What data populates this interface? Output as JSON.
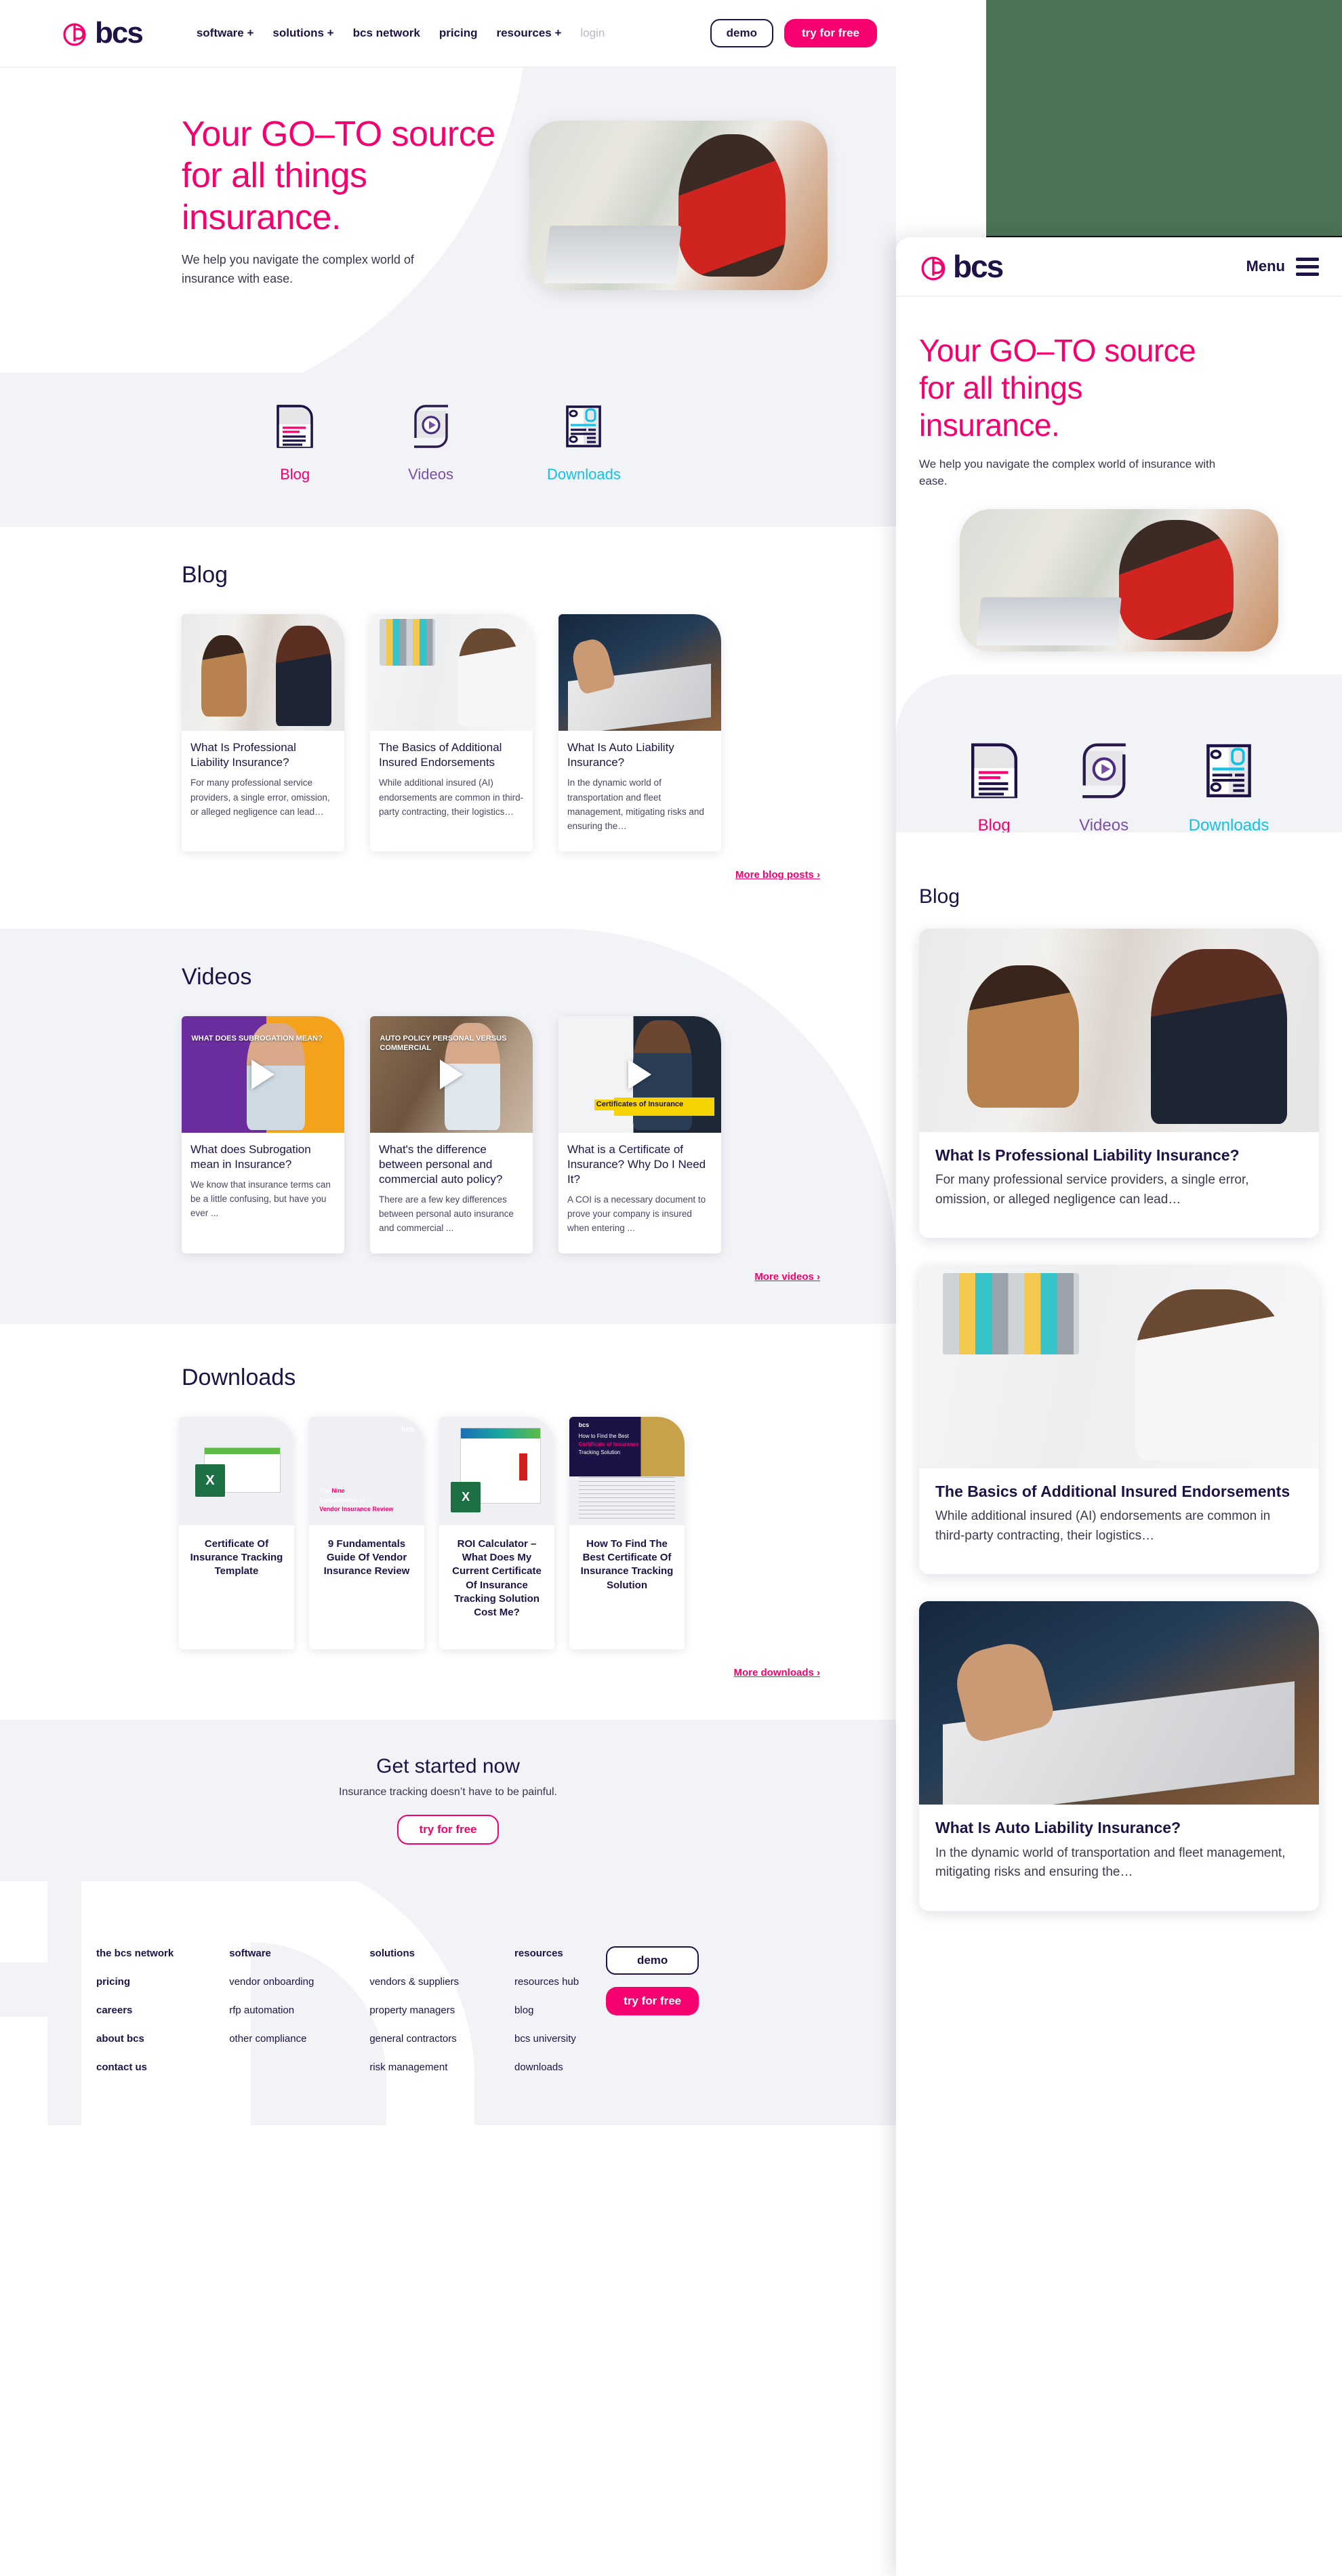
{
  "brand": {
    "name": "bcs",
    "pink": "#f5006e",
    "ink": "#1e1246",
    "cyan": "#12c1e8",
    "purple": "#7b4fa8",
    "green_block": "#4c7354"
  },
  "desktop_header": {
    "nav": [
      {
        "label": "software +"
      },
      {
        "label": "solutions +"
      },
      {
        "label": "bcs network"
      },
      {
        "label": "pricing"
      },
      {
        "label": "resources +"
      },
      {
        "label": "login"
      }
    ],
    "demo_label": "demo",
    "try_label": "try for free"
  },
  "hero": {
    "title_line1": "Your GO–TO source",
    "title_line2": "for all things",
    "title_line3": "insurance.",
    "subtitle": "We help you navigate the complex world of insurance with ease.",
    "image_alt": "woman-at-desk-photo"
  },
  "tabs": [
    {
      "label": "Blog",
      "icon": "blog-document-icon",
      "color": "#f5006e"
    },
    {
      "label": "Videos",
      "icon": "video-play-icon",
      "color": "#7b4fa8"
    },
    {
      "label": "Downloads",
      "icon": "downloads-page-icon",
      "color": "#12c1e8"
    }
  ],
  "blog": {
    "heading": "Blog",
    "more_link": "More blog posts ›",
    "cards": [
      {
        "title": "What Is Professional Liability Insurance?",
        "excerpt": "For many professional service providers, a single error, omission, or alleged negligence can lead…",
        "image_alt": "two-women-meeting-photo"
      },
      {
        "title": "The Basics of Additional Insured Endorsements",
        "excerpt": "While additional insured (AI) endorsements are common in third-party contracting, their logistics…",
        "image_alt": "man-with-folder-photo"
      },
      {
        "title": "What Is Auto Liability Insurance?",
        "excerpt": "In the dynamic world of transportation and fleet management, mitigating risks and ensuring the…",
        "image_alt": "hand-signing-document-photo"
      }
    ]
  },
  "videos": {
    "heading": "Videos",
    "more_link": "More videos ›",
    "cards": [
      {
        "title": "What does Subrogation mean in Insurance?",
        "excerpt": "We know that insurance terms can be a little confusing, but have you ever ...",
        "thumb_text": "WHAT DOES SUBROGATION MEAN?",
        "image_alt": "subrogation-video-thumbnail"
      },
      {
        "title": "What's the difference between personal and commercial auto policy?",
        "excerpt": "There are a few key differences between personal auto insurance and commercial ...",
        "thumb_text": "AUTO POLICY PERSONAL VERSUS COMMERCIAL",
        "image_alt": "personal-vs-commercial-video-thumbnail"
      },
      {
        "title": "What is a Certificate of Insurance? Why Do I Need It?",
        "excerpt": "A COI is a necessary document to prove your company is insured when entering ...",
        "thumb_text": "Certificates of Insurance",
        "image_alt": "certificate-of-insurance-video-thumbnail"
      }
    ]
  },
  "downloads": {
    "heading": "Downloads",
    "more_link": "More downloads ›",
    "cards": [
      {
        "title": "Certificate Of Insurance Tracking Template",
        "cover": "excel-spreadsheet-cover"
      },
      {
        "title": "9 Fundamentals Guide Of Vendor Insurance Review",
        "cover": "nine-fundamentals-ebook-cover",
        "cover_text_1": "The ",
        "cover_text_2": "Nine",
        "cover_text_3": "Fundamentals of",
        "cover_text_4": "Vendor Insurance Review",
        "cover_logo": "bcs"
      },
      {
        "title": "ROI Calculator – What Does My Current Certificate Of Insurance Tracking Solution Cost Me?",
        "cover": "roi-calculator-cover"
      },
      {
        "title": "How To Find The Best Certificate Of Insurance Tracking Solution",
        "cover": "how-to-find-best-coi-cover",
        "cover_logo": "bcs",
        "cover_text_1": "How to Find the Best",
        "cover_text_2": "Certificate of Insurance",
        "cover_text_3": "Tracking Solution"
      }
    ]
  },
  "get_started": {
    "heading": "Get started now",
    "subtitle": "Insurance tracking doesn’t have to be painful.",
    "cta": "try for free"
  },
  "footer": {
    "columns": [
      {
        "bold": true,
        "items": [
          "the bcs network",
          "pricing",
          "careers",
          "about bcs",
          "contact us"
        ]
      },
      {
        "bold": false,
        "heading": "software",
        "items": [
          "software",
          "vendor onboarding",
          "rfp automation",
          "other compliance"
        ]
      },
      {
        "bold": false,
        "heading": "solutions",
        "items": [
          "solutions",
          "vendors & suppliers",
          "property managers",
          "general contractors",
          "risk management"
        ]
      },
      {
        "bold": false,
        "heading": "resources",
        "items": [
          "resources",
          "resources hub",
          "blog",
          "bcs university",
          "downloads"
        ]
      }
    ],
    "demo_label": "demo",
    "try_label": "try for free"
  },
  "mobile": {
    "menu_label": "Menu",
    "logo": "bcs"
  }
}
